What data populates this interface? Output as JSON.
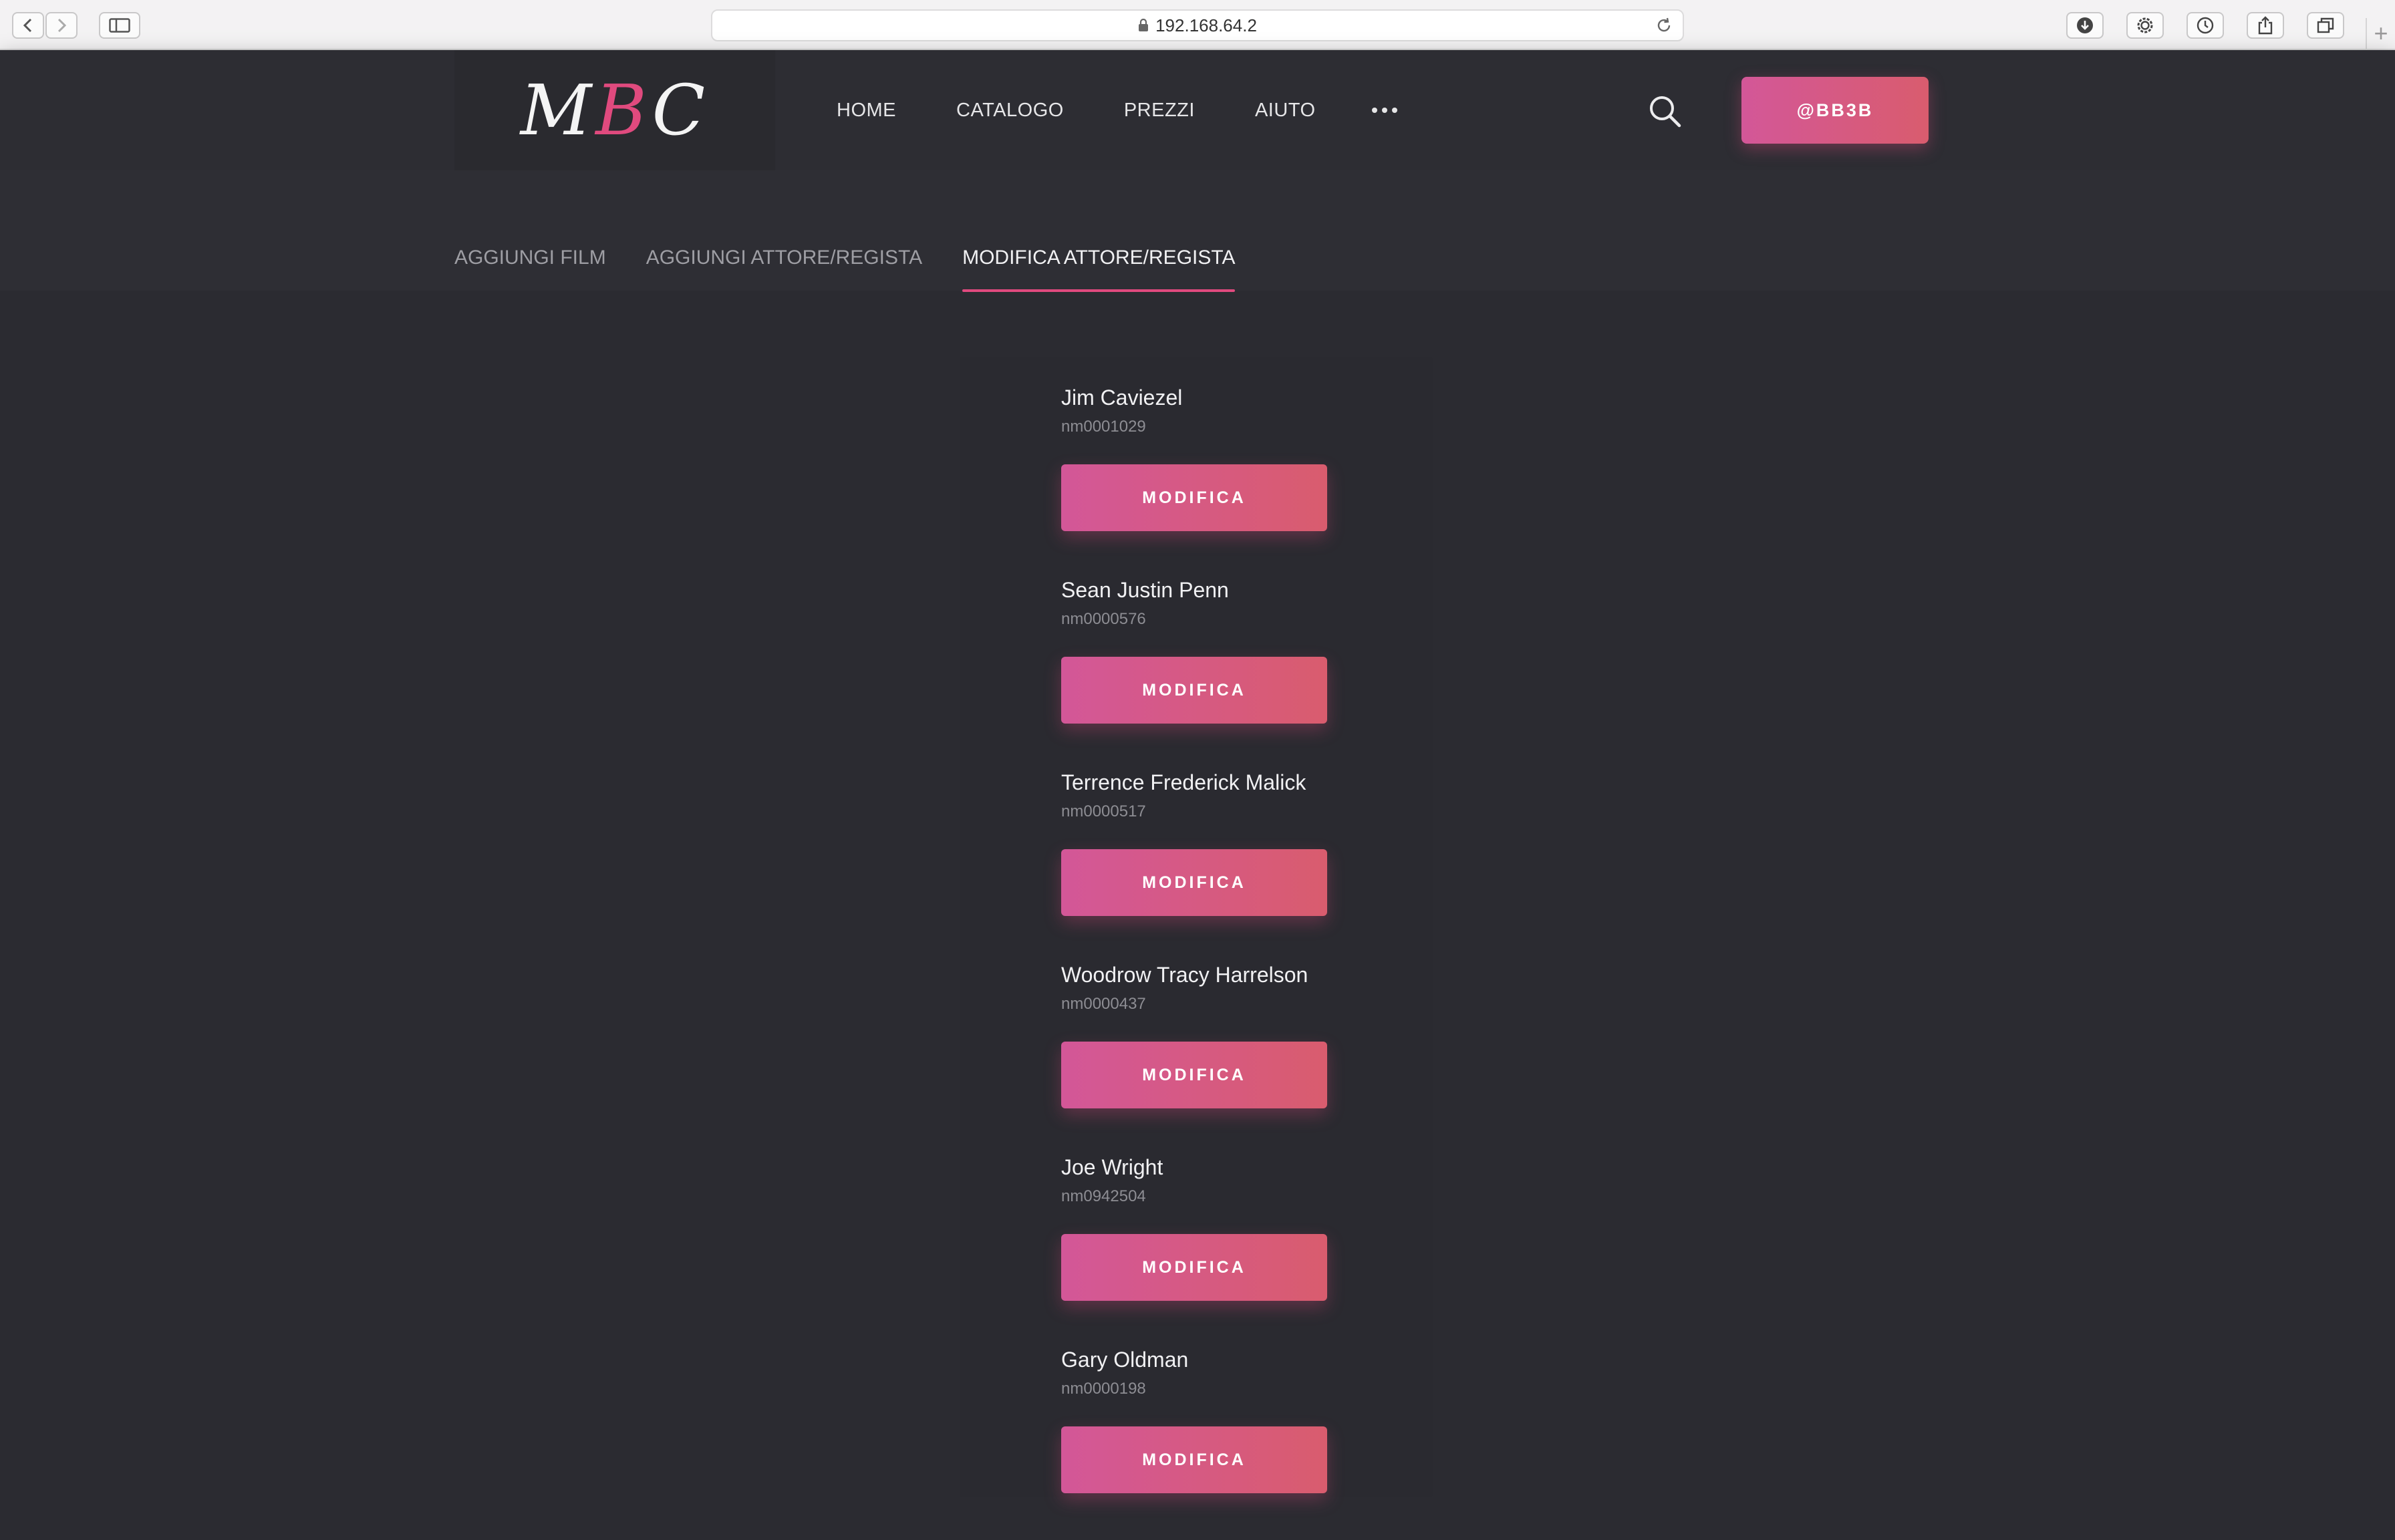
{
  "browser": {
    "url": "192.168.64.2",
    "icons": [
      "back-icon",
      "forward-icon",
      "sidebar-icon",
      "lock-icon",
      "reload-icon",
      "download-icon",
      "settings-icon",
      "history-icon",
      "share-icon",
      "tabs-icon",
      "plus-icon"
    ],
    "new_tab": "+"
  },
  "header": {
    "logo": {
      "left": "M",
      "accent": "B",
      "right": "C"
    },
    "accent_color": "#e04a7e",
    "nav": [
      "HOME",
      "CATALOGO",
      "PREZZI",
      "AIUTO"
    ],
    "more_icon": "more-dots-icon",
    "search_icon": "search-icon",
    "user_label": "@BB3B"
  },
  "subtabs": [
    {
      "label": "AGGIUNGI FILM",
      "active": false
    },
    {
      "label": "AGGIUNGI ATTORE/REGISTA",
      "active": false
    },
    {
      "label": "MODIFICA ATTORE/REGISTA",
      "active": true
    }
  ],
  "people": [
    {
      "name": "Jim Caviezel",
      "id": "nm0001029",
      "button": "MODIFICA"
    },
    {
      "name": "Sean Justin Penn",
      "id": "nm0000576",
      "button": "MODIFICA"
    },
    {
      "name": "Terrence Frederick Malick",
      "id": "nm0000517",
      "button": "MODIFICA"
    },
    {
      "name": "Woodrow Tracy Harrelson",
      "id": "nm0000437",
      "button": "MODIFICA"
    },
    {
      "name": "Joe Wright",
      "id": "nm0942504",
      "button": "MODIFICA"
    },
    {
      "name": "Gary Oldman",
      "id": "nm0000198",
      "button": "MODIFICA"
    }
  ]
}
